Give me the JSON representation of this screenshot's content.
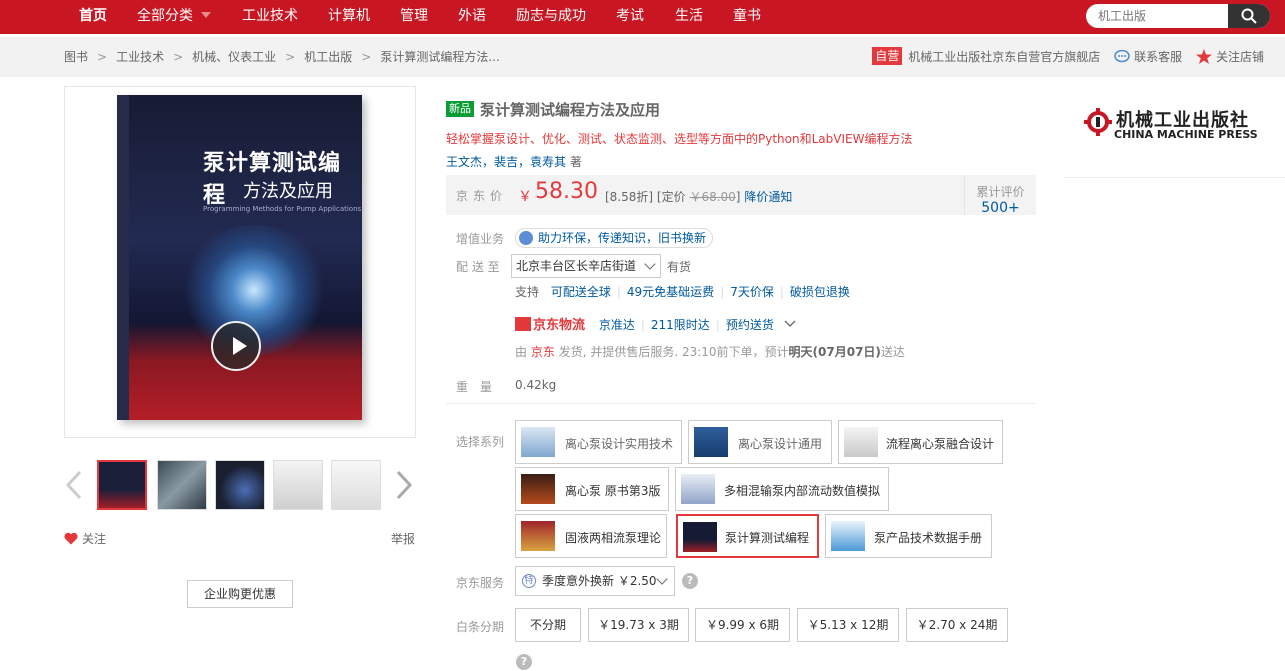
{
  "nav": {
    "items": [
      "首页",
      "全部分类",
      "工业技术",
      "计算机",
      "管理",
      "外语",
      "励志与成功",
      "考试",
      "生活",
      "童书"
    ],
    "search_placeholder": "机工出版"
  },
  "breadcrumb": {
    "items": [
      "图书",
      "工业技术",
      "机械、仪表工业",
      "机工出版",
      "泵计算测试编程方法..."
    ]
  },
  "shop": {
    "badge": "自营",
    "name": "机械工业出版社京东自营官方旗舰店",
    "contact": "联系客服",
    "follow": "关注店铺"
  },
  "gallery": {
    "book_title_line1": "泵计算测试编程",
    "book_title_line2": "方法及应用",
    "book_subtitle": "Programming Methods for Pump Applications",
    "thumb_count": 5,
    "follow_label": "关注",
    "report_label": "举报",
    "corporate_button": "企业购更优惠"
  },
  "product": {
    "tag": "新品",
    "title": "泵计算测试编程方法及应用",
    "slogan": "轻松掌握泵设计、优化、测试、状态监测、选型等方面中的Python和LabVIEW编程方法",
    "authors": "王文杰，裴吉，袁寿其",
    "author_suffix": "著",
    "price_label": "京东价",
    "currency": "￥",
    "price": "58.30",
    "discount": "[8.58折]",
    "list_price_label": "[定价",
    "list_price": "￥68.00",
    "list_price_close": "]",
    "price_notify": "降价通知",
    "reviews_label": "累计评价",
    "reviews_count": "500+"
  },
  "services": {
    "value_added_label": "增值业务",
    "value_added_text": "助力环保，传递知识，旧书换新",
    "delivery_label": "配 送 至",
    "address": "北京丰台区长辛店街道",
    "stock": "有货",
    "support_label": "支持",
    "support_items": [
      "可配送全球",
      "49元免基础运费",
      "7天价保",
      "破损包退换"
    ],
    "logistics_brand": "京东物流",
    "logistics_items": [
      "京准达",
      "211限时达",
      "预约送货"
    ],
    "ship_prefix": "由",
    "ship_seller": "京东",
    "ship_mid": "发货, 并提供售后服务. 23:10前下单，预计",
    "ship_date": "明天(07月07日)",
    "ship_suffix": "送达",
    "weight_label": "重　量",
    "weight": "0.42kg"
  },
  "series": {
    "label": "选择系列",
    "items": [
      "离心泵设计实用技术",
      "离心泵设计通用",
      "流程离心泵融合设计",
      "离心泵 原书第3版",
      "多相混输泵内部流动数值模拟",
      "固液两相流泵理论",
      "泵计算测试编程",
      "泵产品技术数据手册"
    ]
  },
  "jd_service": {
    "label": "京东服务",
    "icon_text": "特",
    "value": "季度意外换新 ￥2.50"
  },
  "installment": {
    "label": "白条分期",
    "options": [
      "不分期",
      "￥19.73 x 3期",
      "￥9.99 x 6期",
      "￥5.13 x 12期",
      "￥2.70 x 24期"
    ]
  },
  "publisher": {
    "name_cn": "机械工业出版社",
    "name_en": "CHINA MACHINE PRESS"
  },
  "colors": {
    "brand_red": "#c81623",
    "price_red": "#e4393c",
    "link_blue": "#005aa0",
    "new_tag_green": "#0b9c35"
  }
}
